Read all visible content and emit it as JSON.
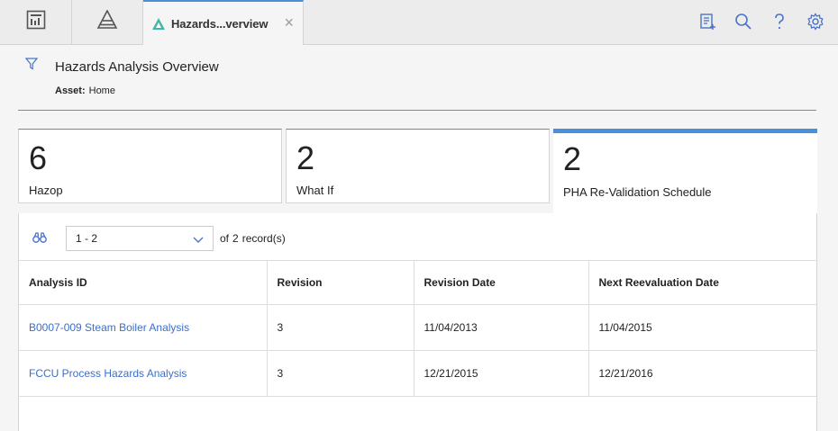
{
  "tabs": {
    "active_title": "Hazards...verview",
    "close": "×"
  },
  "header": {
    "title": "Hazards Analysis Overview",
    "asset_label": "Asset:",
    "asset_value": "Home"
  },
  "cards": [
    {
      "count": "6",
      "label": "Hazop"
    },
    {
      "count": "2",
      "label": "What If"
    },
    {
      "count": "2",
      "label": "PHA Re-Validation Schedule"
    }
  ],
  "toolbar": {
    "range_value": "1 - 2",
    "of_label": "of",
    "record_count": "2",
    "records_label": "record(s)"
  },
  "table": {
    "columns": [
      "Analysis ID",
      "Revision",
      "Revision Date",
      "Next Reevaluation Date"
    ],
    "rows": [
      [
        "B0007-009 Steam Boiler Analysis",
        "3",
        "11/04/2013",
        "11/04/2015"
      ],
      [
        "FCCU Process Hazards Analysis",
        "3",
        "12/21/2015",
        "12/21/2016"
      ]
    ]
  },
  "colors": {
    "accent": "#4a90d9",
    "link": "#3b6fc9"
  }
}
